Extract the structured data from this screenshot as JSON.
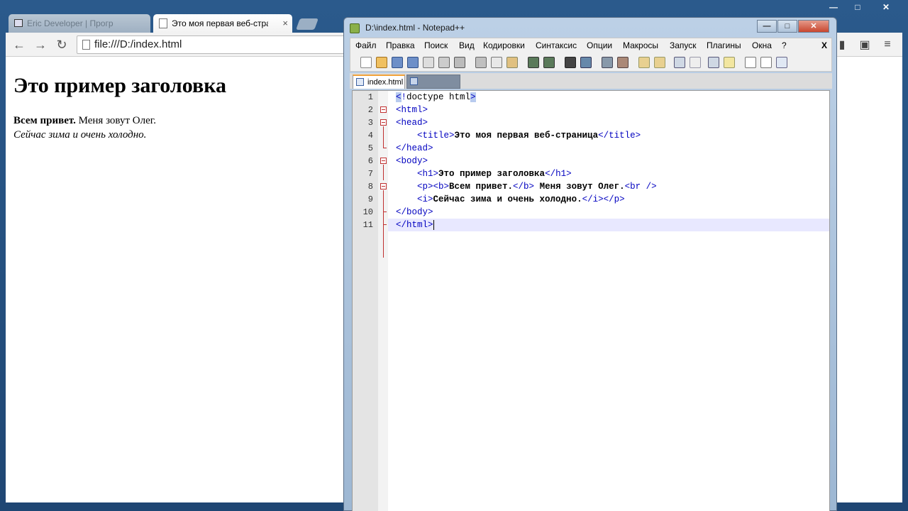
{
  "browser": {
    "tabs": [
      {
        "title": "Eric Developer | Прогр"
      },
      {
        "title": "Это моя первая веб-стран",
        "close": "×"
      }
    ],
    "nav": {
      "back": "←",
      "forward": "→",
      "reload": "↻"
    },
    "url": "file:///D:/index.html",
    "window_controls": {
      "minimize": "—",
      "maximize": "□",
      "close": "✕"
    }
  },
  "page": {
    "heading": "Это пример заголовка",
    "p_bold": "Всем привет.",
    "p_rest": " Меня зовут Олег.",
    "p_italic": "Сейчас зима и очень холодно."
  },
  "npp": {
    "title": "D:\\index.html - Notepad++",
    "window_controls": {
      "minimize": "—",
      "maximize": "□",
      "close": "✕"
    },
    "menu": [
      "Файл",
      "Правка",
      "Поиск",
      "Вид",
      "Кодировки",
      "Синтаксис",
      "Опции",
      "Макросы",
      "Запуск",
      "Плагины",
      "Окна",
      "?"
    ],
    "menu_close": "X",
    "tabs": [
      {
        "label": "index.html"
      },
      {
        "label": ""
      }
    ],
    "line_numbers": [
      "1",
      "2",
      "3",
      "4",
      "5",
      "6",
      "7",
      "8",
      "9",
      "10",
      "11"
    ]
  },
  "colors": {
    "tag": "#0000c0",
    "current_line": "#e8e8ff",
    "fold": "#c03030"
  }
}
